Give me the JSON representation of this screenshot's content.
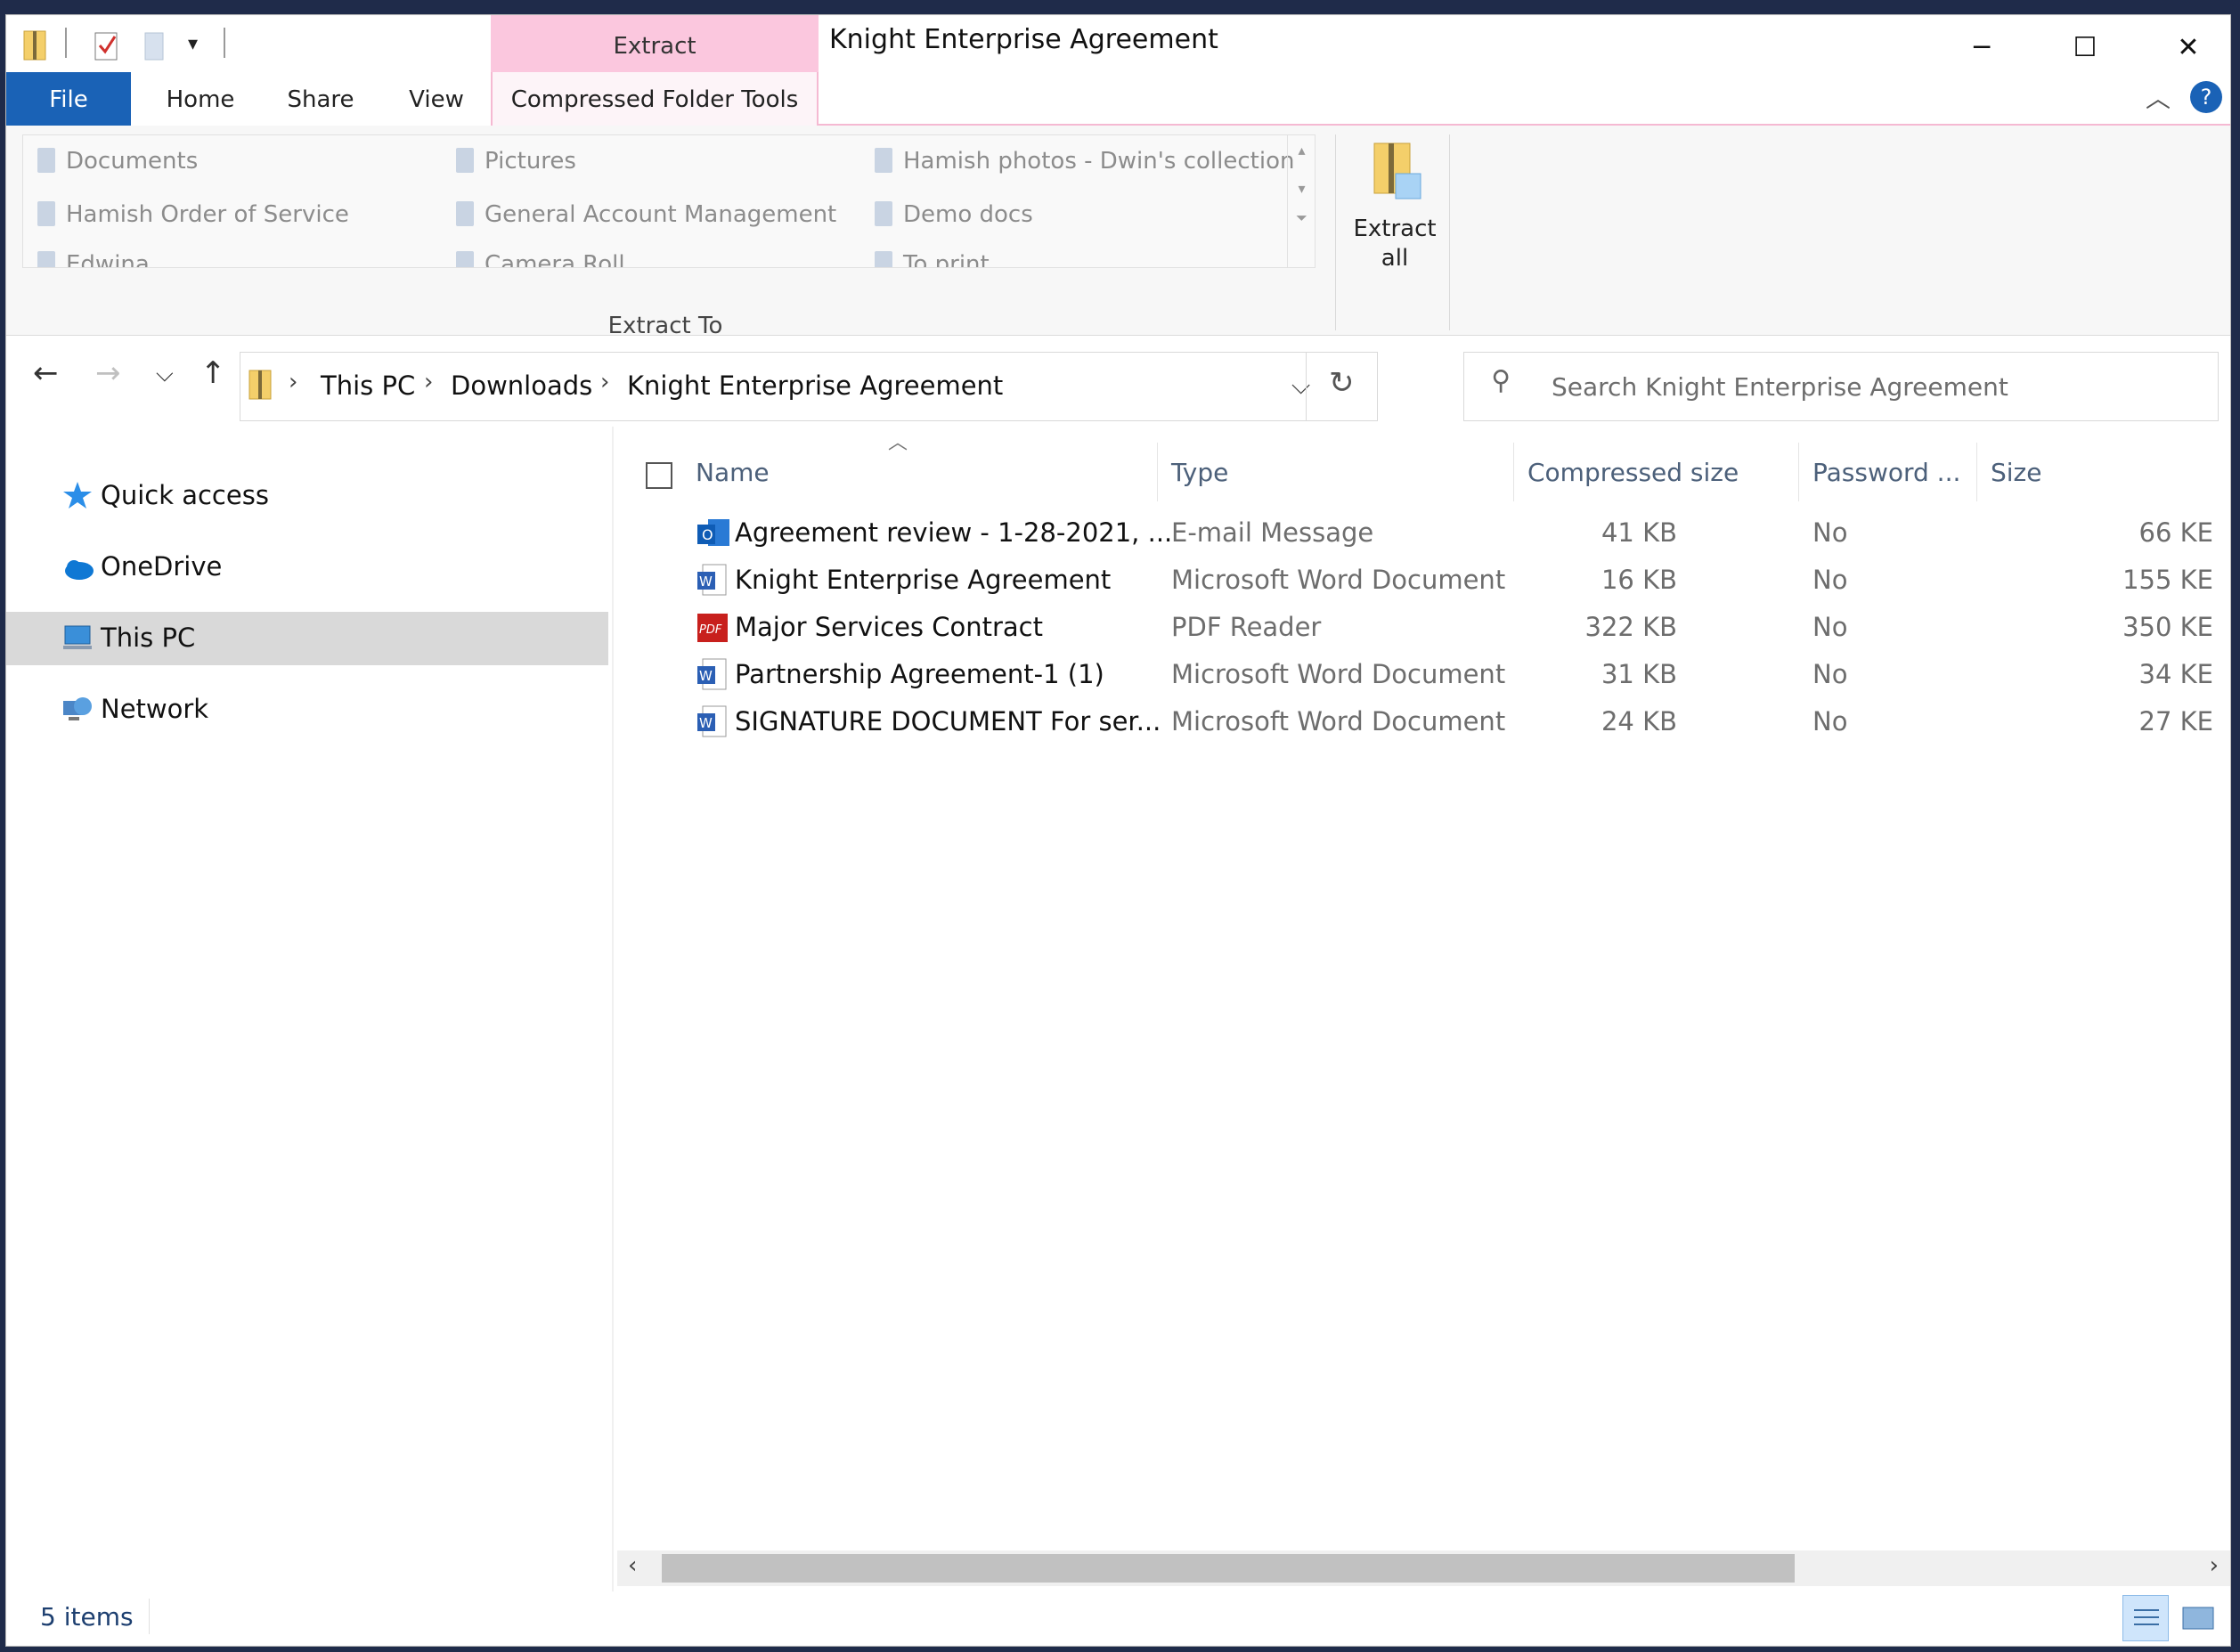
{
  "window": {
    "title": "Knight Enterprise Agreement"
  },
  "ribbon": {
    "contextual_header": "Extract",
    "tabs": [
      {
        "label": "File"
      },
      {
        "label": "Home"
      },
      {
        "label": "Share"
      },
      {
        "label": "View"
      },
      {
        "label": "Compressed Folder Tools"
      }
    ],
    "extract_to": {
      "group_label": "Extract To",
      "destinations": [
        "Documents",
        "Pictures",
        "Hamish photos - Dwin's collection",
        "Hamish Order of Service",
        "General Account Management",
        "Demo docs",
        "Edwina",
        "Camera Roll",
        "To print"
      ]
    },
    "extract_all_label_line1": "Extract",
    "extract_all_label_line2": "all"
  },
  "address": {
    "breadcrumb": [
      "This PC",
      "Downloads",
      "Knight Enterprise Agreement"
    ],
    "search_placeholder": "Search Knight Enterprise Agreement"
  },
  "nav_pane": {
    "items": [
      {
        "label": "Quick access",
        "icon": "star-icon"
      },
      {
        "label": "OneDrive",
        "icon": "cloud-icon"
      },
      {
        "label": "This PC",
        "icon": "computer-icon",
        "selected": true
      },
      {
        "label": "Network",
        "icon": "network-icon"
      }
    ]
  },
  "file_list": {
    "columns": [
      "Name",
      "Type",
      "Compressed size",
      "Password ...",
      "Size"
    ],
    "rows": [
      {
        "name": "Agreement review - 1-28-2021, ...",
        "type": "E-mail Message",
        "compressed": "41 KB",
        "password": "No",
        "size": "66 KE",
        "icon": "outlook-icon"
      },
      {
        "name": "Knight Enterprise Agreement",
        "type": "Microsoft Word Document",
        "compressed": "16 KB",
        "password": "No",
        "size": "155 KE",
        "icon": "word-icon"
      },
      {
        "name": "Major Services Contract",
        "type": "PDF Reader",
        "compressed": "322 KB",
        "password": "No",
        "size": "350 KE",
        "icon": "pdf-icon"
      },
      {
        "name": "Partnership Agreement-1 (1)",
        "type": "Microsoft Word Document",
        "compressed": "31 KB",
        "password": "No",
        "size": "34 KE",
        "icon": "word-icon"
      },
      {
        "name": "SIGNATURE DOCUMENT For ser...",
        "type": "Microsoft Word Document",
        "compressed": "24 KB",
        "password": "No",
        "size": "27 KE",
        "icon": "word-icon"
      }
    ]
  },
  "status": {
    "item_count": "5 items"
  },
  "colors": {
    "accent": "#1a62b6",
    "contextual_tab": "#fbc7de",
    "selection": "#d9d9d9"
  }
}
